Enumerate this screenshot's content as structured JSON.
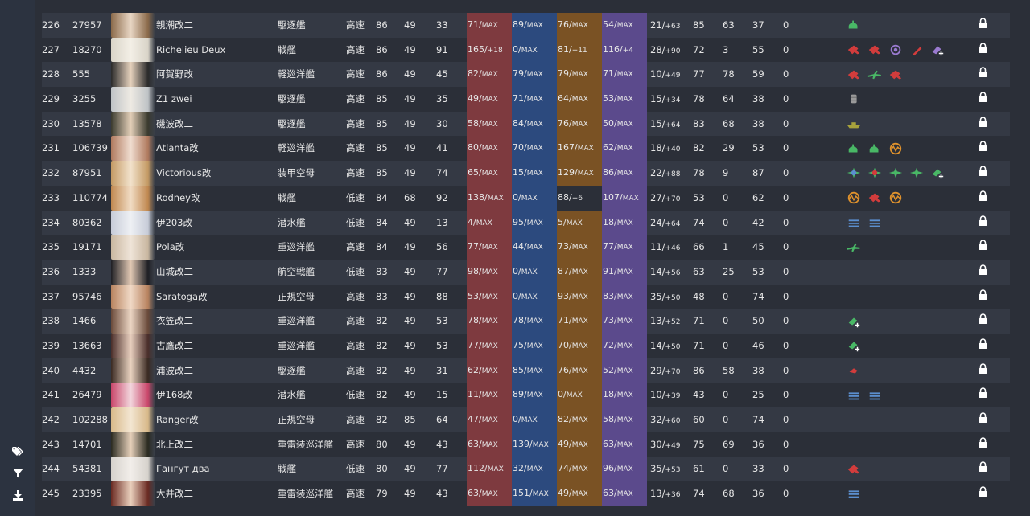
{
  "sidebar": {
    "icons": [
      "tags-icon",
      "filter-icon",
      "download-icon"
    ]
  },
  "colors": {
    "fp": "#7e3a3f",
    "tp": "#2c4a7e",
    "aa": "#7a5224",
    "ar": "#5b4a8c",
    "eq_red": "#d23c3c",
    "eq_green": "#49b866",
    "eq_orange": "#e0922c",
    "eq_blue": "#5b8fcf",
    "eq_gray": "#9a9a9a",
    "eq_olive": "#a7a23c",
    "eq_purple": "#9a7ad0"
  },
  "rows": [
    {
      "idx": "226",
      "sid": "27957",
      "name": "親潮改二",
      "type": "駆逐艦",
      "speed": "高速",
      "lv": "86",
      "cond": "49",
      "n3": "33",
      "fp": "71/",
      "fpx": "MAX",
      "tp": "89/",
      "tpx": "MAX",
      "aa": "76/",
      "aax": "MAX",
      "ar": "54/",
      "arx": "MAX",
      "luck": "21/",
      "luckx": "+63",
      "eva": "85",
      "asw": "63",
      "los": "37",
      "zero": "0",
      "eq": [
        "green-radar"
      ],
      "portrait": [
        "#8b6a4a",
        "#e8d6c4"
      ]
    },
    {
      "idx": "227",
      "sid": "18270",
      "name": "Richelieu Deux",
      "type": "戦艦",
      "speed": "高速",
      "lv": "86",
      "cond": "49",
      "n3": "91",
      "fp": "165/",
      "fpx": "+18",
      "tp": "0/",
      "tpx": "MAX",
      "aa": "81/",
      "aax": "+11",
      "ar": "116/",
      "arx": "+4",
      "luck": "28/",
      "luckx": "+90",
      "eva": "72",
      "asw": "3",
      "los": "55",
      "zero": "0",
      "eq": [
        "red-gun",
        "red-gun",
        "purple-seal",
        "red-shell",
        "purple-add"
      ],
      "portrait": [
        "#d9d4c8",
        "#f3efe6"
      ]
    },
    {
      "idx": "228",
      "sid": "555",
      "name": "阿賀野改",
      "type": "軽巡洋艦",
      "speed": "高速",
      "lv": "86",
      "cond": "49",
      "n3": "45",
      "fp": "82/",
      "fpx": "MAX",
      "tp": "79/",
      "tpx": "MAX",
      "aa": "79/",
      "aax": "MAX",
      "ar": "71/",
      "arx": "MAX",
      "luck": "10/",
      "luckx": "+49",
      "eva": "77",
      "asw": "78",
      "los": "59",
      "zero": "0",
      "eq": [
        "red-gun",
        "green-plane",
        "red-gun"
      ],
      "portrait": [
        "#2a2a2a",
        "#e6d2bd"
      ]
    },
    {
      "idx": "229",
      "sid": "3255",
      "name": "Z1 zwei",
      "type": "駆逐艦",
      "speed": "高速",
      "lv": "85",
      "cond": "49",
      "n3": "35",
      "fp": "49/",
      "fpx": "MAX",
      "tp": "71/",
      "tpx": "MAX",
      "aa": "64/",
      "aax": "MAX",
      "ar": "53/",
      "arx": "MAX",
      "luck": "15/",
      "luckx": "+34",
      "eva": "78",
      "asw": "64",
      "los": "38",
      "zero": "0",
      "eq": [
        "gray-drum"
      ],
      "portrait": [
        "#bfc3c6",
        "#eeeae3"
      ]
    },
    {
      "idx": "230",
      "sid": "13578",
      "name": "磯波改二",
      "type": "駆逐艦",
      "speed": "高速",
      "lv": "85",
      "cond": "49",
      "n3": "30",
      "fp": "58/",
      "fpx": "MAX",
      "tp": "84/",
      "tpx": "MAX",
      "aa": "76/",
      "aax": "MAX",
      "ar": "50/",
      "arx": "MAX",
      "luck": "15/",
      "luckx": "+64",
      "eva": "83",
      "asw": "68",
      "los": "38",
      "zero": "0",
      "eq": [
        "olive-boat"
      ],
      "portrait": [
        "#3a3a2e",
        "#e3cfb8"
      ]
    },
    {
      "idx": "231",
      "sid": "106739",
      "name": "Atlanta改",
      "type": "軽巡洋艦",
      "speed": "高速",
      "lv": "85",
      "cond": "49",
      "n3": "41",
      "fp": "80/",
      "fpx": "MAX",
      "tp": "70/",
      "tpx": "MAX",
      "aa": "167/",
      "aax": "MAX",
      "ar": "62/",
      "arx": "MAX",
      "luck": "18/",
      "luckx": "+40",
      "eva": "82",
      "asw": "29",
      "los": "53",
      "zero": "0",
      "eq": [
        "green-radar",
        "green-radar",
        "orange-radar"
      ],
      "portrait": [
        "#b07a5e",
        "#f0ddd0"
      ]
    },
    {
      "idx": "232",
      "sid": "87951",
      "name": "Victorious改",
      "type": "装甲空母",
      "speed": "高速",
      "lv": "85",
      "cond": "49",
      "n3": "74",
      "fp": "65/",
      "fpx": "MAX",
      "tp": "15/",
      "tpx": "MAX",
      "aa": "129/",
      "aax": "MAX",
      "ar": "86/",
      "arx": "MAX",
      "luck": "22/",
      "luckx": "+88",
      "eva": "78",
      "asw": "9",
      "los": "87",
      "zero": "0",
      "eq": [
        "green-fighter-blue",
        "green-fighter-red",
        "green-fighter",
        "green-fighter",
        "green-add"
      ],
      "portrait": [
        "#c49a64",
        "#f2e2cc"
      ]
    },
    {
      "idx": "233",
      "sid": "110774",
      "name": "Rodney改",
      "type": "戦艦",
      "speed": "低速",
      "lv": "84",
      "cond": "68",
      "n3": "92",
      "fp": "138/",
      "fpx": "MAX",
      "tp": "0/",
      "tpx": "MAX",
      "aa": "88/",
      "aax": "+6",
      "ar": "107/",
      "arx": "MAX",
      "luck": "27/",
      "luckx": "+70",
      "eva": "53",
      "asw": "0",
      "los": "62",
      "zero": "0",
      "eq": [
        "orange-radar",
        "red-gun",
        "orange-radar"
      ],
      "portrait": [
        "#c08850",
        "#f1dcc4"
      ],
      "aadark": true
    },
    {
      "idx": "234",
      "sid": "80362",
      "name": "伊203改",
      "type": "潜水艦",
      "speed": "低速",
      "lv": "84",
      "cond": "49",
      "n3": "13",
      "fp": "4/",
      "fpx": "MAX",
      "tp": "95/",
      "tpx": "MAX",
      "aa": "5/",
      "aax": "MAX",
      "ar": "18/",
      "arx": "MAX",
      "luck": "24/",
      "luckx": "+64",
      "eva": "74",
      "asw": "0",
      "los": "42",
      "zero": "0",
      "eq": [
        "blue-torpedo",
        "blue-torpedo"
      ],
      "portrait": [
        "#c7ccd8",
        "#eef0f4"
      ]
    },
    {
      "idx": "235",
      "sid": "19171",
      "name": "Pola改",
      "type": "重巡洋艦",
      "speed": "高速",
      "lv": "84",
      "cond": "49",
      "n3": "56",
      "fp": "77/",
      "fpx": "MAX",
      "tp": "44/",
      "tpx": "MAX",
      "aa": "73/",
      "aax": "MAX",
      "ar": "77/",
      "arx": "MAX",
      "luck": "11/",
      "luckx": "+46",
      "eva": "66",
      "asw": "1",
      "los": "45",
      "zero": "0",
      "eq": [
        "green-plane"
      ],
      "portrait": [
        "#c9b7a0",
        "#efe4d8"
      ]
    },
    {
      "idx": "236",
      "sid": "1333",
      "name": "山城改二",
      "type": "航空戦艦",
      "speed": "低速",
      "lv": "83",
      "cond": "49",
      "n3": "77",
      "fp": "98/",
      "fpx": "MAX",
      "tp": "0/",
      "tpx": "MAX",
      "aa": "87/",
      "aax": "MAX",
      "ar": "91/",
      "arx": "MAX",
      "luck": "14/",
      "luckx": "+56",
      "eva": "63",
      "asw": "25",
      "los": "53",
      "zero": "0",
      "eq": [],
      "portrait": [
        "#1f1f24",
        "#e2c9b4"
      ]
    },
    {
      "idx": "237",
      "sid": "95746",
      "name": "Saratoga改",
      "type": "正規空母",
      "speed": "高速",
      "lv": "83",
      "cond": "49",
      "n3": "88",
      "fp": "53/",
      "fpx": "MAX",
      "tp": "0/",
      "tpx": "MAX",
      "aa": "93/",
      "aax": "MAX",
      "ar": "83/",
      "arx": "MAX",
      "luck": "35/",
      "luckx": "+50",
      "eva": "48",
      "asw": "0",
      "los": "74",
      "zero": "0",
      "eq": [],
      "portrait": [
        "#b8835f",
        "#f0d9c6"
      ]
    },
    {
      "idx": "238",
      "sid": "1466",
      "name": "衣笠改二",
      "type": "重巡洋艦",
      "speed": "高速",
      "lv": "82",
      "cond": "49",
      "n3": "53",
      "fp": "78/",
      "fpx": "MAX",
      "tp": "78/",
      "tpx": "MAX",
      "aa": "71/",
      "aax": "MAX",
      "ar": "73/",
      "arx": "MAX",
      "luck": "13/",
      "luckx": "+52",
      "eva": "71",
      "asw": "0",
      "los": "50",
      "zero": "0",
      "eq": [
        "green-add"
      ],
      "portrait": [
        "#6a4a3a",
        "#ecd6c4"
      ]
    },
    {
      "idx": "239",
      "sid": "13663",
      "name": "古鷹改二",
      "type": "重巡洋艦",
      "speed": "高速",
      "lv": "82",
      "cond": "49",
      "n3": "53",
      "fp": "77/",
      "fpx": "MAX",
      "tp": "75/",
      "tpx": "MAX",
      "aa": "70/",
      "aax": "MAX",
      "ar": "72/",
      "arx": "MAX",
      "luck": "14/",
      "luckx": "+50",
      "eva": "71",
      "asw": "0",
      "los": "46",
      "zero": "0",
      "eq": [
        "green-add"
      ],
      "portrait": [
        "#4a2e2a",
        "#e8cfbe"
      ]
    },
    {
      "idx": "240",
      "sid": "4432",
      "name": "浦波改二",
      "type": "駆逐艦",
      "speed": "高速",
      "lv": "82",
      "cond": "49",
      "n3": "31",
      "fp": "62/",
      "fpx": "MAX",
      "tp": "85/",
      "tpx": "MAX",
      "aa": "76/",
      "aax": "MAX",
      "ar": "52/",
      "arx": "MAX",
      "luck": "29/",
      "luckx": "+70",
      "eva": "86",
      "asw": "58",
      "los": "38",
      "zero": "0",
      "eq": [
        "red-small"
      ],
      "portrait": [
        "#3a2a22",
        "#ead3c0"
      ]
    },
    {
      "idx": "241",
      "sid": "26479",
      "name": "伊168改",
      "type": "潜水艦",
      "speed": "低速",
      "lv": "82",
      "cond": "49",
      "n3": "15",
      "fp": "11/",
      "fpx": "MAX",
      "tp": "89/",
      "tpx": "MAX",
      "aa": "0/",
      "aax": "MAX",
      "ar": "18/",
      "arx": "MAX",
      "luck": "10/",
      "luckx": "+39",
      "eva": "43",
      "asw": "0",
      "los": "25",
      "zero": "0",
      "eq": [
        "blue-torpedo",
        "blue-torpedo"
      ],
      "portrait": [
        "#c9466a",
        "#f2d6dd"
      ]
    },
    {
      "idx": "242",
      "sid": "102288",
      "name": "Ranger改",
      "type": "正規空母",
      "speed": "高速",
      "lv": "82",
      "cond": "85",
      "n3": "64",
      "fp": "47/",
      "fpx": "MAX",
      "tp": "0/",
      "tpx": "MAX",
      "aa": "82/",
      "aax": "MAX",
      "ar": "58/",
      "arx": "MAX",
      "luck": "32/",
      "luckx": "+60",
      "eva": "60",
      "asw": "0",
      "los": "74",
      "zero": "0",
      "eq": [],
      "portrait": [
        "#d8b98a",
        "#f3e6d2"
      ]
    },
    {
      "idx": "243",
      "sid": "14701",
      "name": "北上改二",
      "type": "重雷装巡洋艦",
      "speed": "高速",
      "lv": "80",
      "cond": "49",
      "n3": "43",
      "fp": "63/",
      "fpx": "MAX",
      "tp": "139/",
      "tpx": "MAX",
      "aa": "49/",
      "aax": "MAX",
      "ar": "63/",
      "arx": "MAX",
      "luck": "30/",
      "luckx": "+49",
      "eva": "75",
      "asw": "69",
      "los": "36",
      "zero": "0",
      "eq": [],
      "portrait": [
        "#2a2a20",
        "#e6d0ba"
      ]
    },
    {
      "idx": "244",
      "sid": "54381",
      "name": "Гангут два",
      "type": "戦艦",
      "speed": "低速",
      "lv": "80",
      "cond": "49",
      "n3": "77",
      "fp": "112/",
      "fpx": "MAX",
      "tp": "32/",
      "tpx": "MAX",
      "aa": "74/",
      "aax": "MAX",
      "ar": "96/",
      "arx": "MAX",
      "luck": "35/",
      "luckx": "+53",
      "eva": "61",
      "asw": "0",
      "los": "33",
      "zero": "0",
      "eq": [
        "red-gun"
      ],
      "portrait": [
        "#d6d2cc",
        "#f2eeea"
      ]
    },
    {
      "idx": "245",
      "sid": "23395",
      "name": "大井改二",
      "type": "重雷装巡洋艦",
      "speed": "高速",
      "lv": "79",
      "cond": "49",
      "n3": "43",
      "fp": "63/",
      "fpx": "MAX",
      "tp": "151/",
      "tpx": "MAX",
      "aa": "49/",
      "aax": "MAX",
      "ar": "63/",
      "arx": "MAX",
      "luck": "13/",
      "luckx": "+36",
      "eva": "74",
      "asw": "68",
      "los": "36",
      "zero": "0",
      "eq": [
        "blue-torpedo"
      ],
      "portrait": [
        "#6a2a22",
        "#ead0bd"
      ]
    }
  ]
}
